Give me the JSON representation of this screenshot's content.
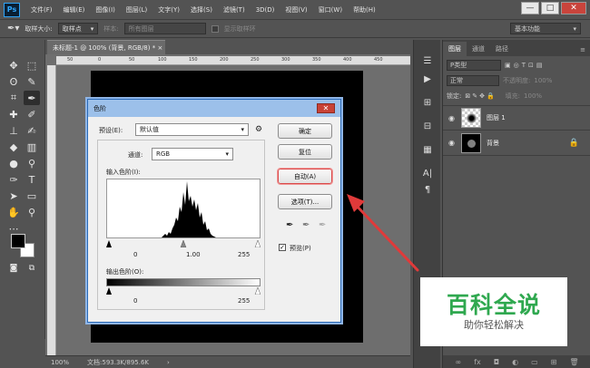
{
  "app": {
    "logo": "Ps",
    "menus": [
      "文件(F)",
      "编辑(E)",
      "图像(I)",
      "图层(L)",
      "文字(Y)",
      "选择(S)",
      "滤镜(T)",
      "3D(D)",
      "视图(V)",
      "窗口(W)",
      "帮助(H)"
    ],
    "window_controls": {
      "minimize": "—",
      "restore": "□",
      "close": "✕"
    }
  },
  "options_bar": {
    "sample_size_label": "取样大小:",
    "sample_size_value": "取样点",
    "sample_label": "样本:",
    "sample_value": "所有图层",
    "show_ring_label": "显示取样环",
    "workspace": "基本功能"
  },
  "document": {
    "tab_title": "未标题-1 @ 100% (背景, RGB/8) *",
    "ruler_ticks": [
      "50",
      "0",
      "50",
      "100",
      "150",
      "200",
      "250",
      "300",
      "350",
      "400",
      "450"
    ]
  },
  "status_bar": {
    "zoom": "100%",
    "doc_info": "文档:593.3K/895.6K"
  },
  "layers_panel": {
    "tabs": [
      "图层",
      "通道",
      "路径"
    ],
    "filter_kind": "P类型",
    "blend_mode": "正常",
    "opacity_label": "不透明度:",
    "opacity_value": "100%",
    "lock_label": "锁定:",
    "fill_label": "填充:",
    "fill_value": "100%",
    "layers": [
      {
        "name": "图层 1",
        "visible": true,
        "locked": false
      },
      {
        "name": "背景",
        "visible": true,
        "locked": true
      }
    ],
    "bottom_icons": [
      "link-icon",
      "fx",
      "mask-icon",
      "adjust-icon",
      "folder-icon",
      "new-icon",
      "trash-icon"
    ]
  },
  "levels_dialog": {
    "title": "色阶",
    "preset_label": "预设(E):",
    "preset_value": "默认值",
    "channel_label": "通道:",
    "channel_value": "RGB",
    "input_levels_label": "输入色阶(I):",
    "input_values": {
      "black": "0",
      "gray": "1.00",
      "white": "255"
    },
    "output_levels_label": "输出色阶(O):",
    "output_values": {
      "black": "0",
      "white": "255"
    },
    "buttons": {
      "ok": "确定",
      "reset": "复位",
      "auto": "自动(A)",
      "options": "选项(T)..."
    },
    "preview_label": "预览(P)",
    "preview_checked": true
  },
  "watermark": {
    "title": "百科全说",
    "subtitle": "助你轻松解决",
    "title_color": "#2fa84f"
  },
  "colors": {
    "foreground": "#000000",
    "background": "#ffffff",
    "annotation_red": "#e03a3a"
  }
}
